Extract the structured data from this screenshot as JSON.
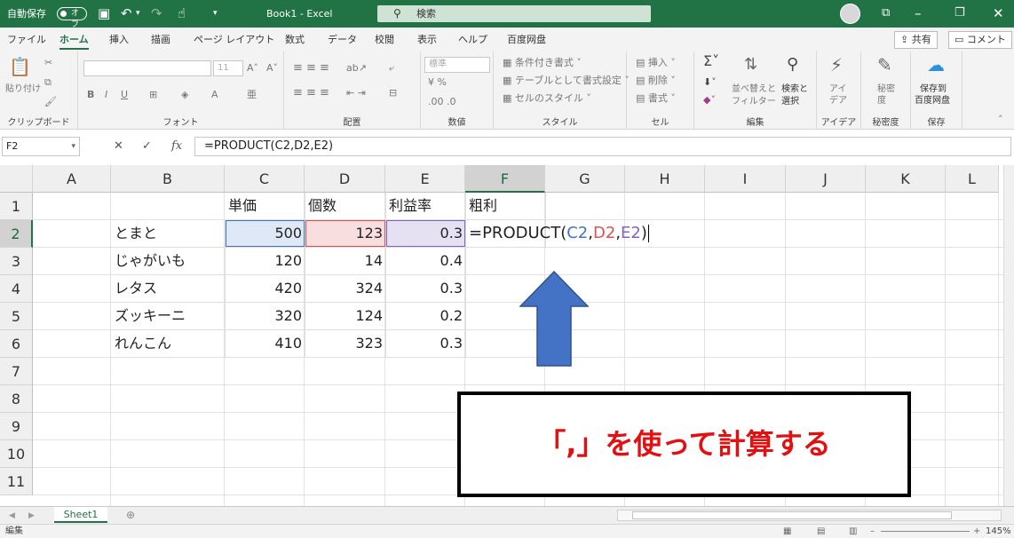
{
  "titlebar": {
    "autosave_label": "自動保存",
    "autosave_state": "オフ",
    "app_title": "Book1  -  Excel",
    "search_placeholder": "検索"
  },
  "menu": {
    "tabs": [
      "ファイル",
      "ホーム",
      "挿入",
      "描画",
      "ページ レイアウト",
      "数式",
      "データ",
      "校閲",
      "表示",
      "ヘルプ",
      "百度网盘"
    ],
    "active": "ホーム",
    "share": "共有",
    "comment": "コメント"
  },
  "ribbon": {
    "clipboard": {
      "label": "クリップボード",
      "paste": "貼り付け"
    },
    "font": {
      "label": "フォント",
      "size": "11"
    },
    "alignment": {
      "label": "配置"
    },
    "number": {
      "label": "数値",
      "format": "標準"
    },
    "styles": {
      "label": "スタイル",
      "conditional": "条件付き書式",
      "table": "テーブルとして書式設定",
      "cell_styles": "セルのスタイル"
    },
    "cells": {
      "label": "セル",
      "insert": "挿入",
      "delete": "削除",
      "format": "書式"
    },
    "editing": {
      "label": "編集",
      "sort": "並べ替えと",
      "filter": "フィルター",
      "find": "検索と",
      "select": "選択"
    },
    "ideas": {
      "label": "アイデア",
      "name": "アイ\nデア"
    },
    "sensitivity": {
      "label": "秘密度",
      "name": "秘密\n度"
    },
    "save": {
      "label": "保存",
      "name1": "保存到",
      "name2": "百度网盘"
    }
  },
  "formula_bar": {
    "name_box": "F2",
    "formula": "=PRODUCT(C2,D2,E2)"
  },
  "grid": {
    "columns": [
      "A",
      "B",
      "C",
      "D",
      "E",
      "F",
      "G",
      "H",
      "I",
      "J",
      "K",
      "L"
    ],
    "selected_column": "F",
    "rows": [
      "1",
      "2",
      "3",
      "4",
      "5",
      "6",
      "7",
      "8",
      "9",
      "10",
      "11"
    ],
    "selected_row": "2",
    "headers": {
      "C": "単価",
      "D": "個数",
      "E": "利益率",
      "F": "粗利"
    },
    "data": [
      {
        "name": "とまと",
        "price": "500",
        "qty": "123",
        "margin": "0.3"
      },
      {
        "name": "じゃがいも",
        "price": "120",
        "qty": "14",
        "margin": "0.4"
      },
      {
        "name": "レタス",
        "price": "420",
        "qty": "324",
        "margin": "0.3"
      },
      {
        "name": "ズッキーニ",
        "price": "320",
        "qty": "124",
        "margin": "0.2"
      },
      {
        "name": "れんこん",
        "price": "410",
        "qty": "323",
        "margin": "0.3"
      }
    ],
    "edit_formula": {
      "prefix": "=PRODUCT(",
      "ref1": "C2",
      "sep1": ",",
      "ref2": "D2",
      "sep2": ",",
      "ref3": "E2",
      "suffix": ")"
    }
  },
  "annotation": {
    "callout_text": "「,」を使って計算する",
    "arrow_color": "#4472c4",
    "text_color": "#e21010"
  },
  "sheet_tabs": {
    "active": "Sheet1"
  },
  "status": {
    "mode": "編集",
    "zoom": "145%"
  },
  "colors": {
    "accent": "#217346",
    "ref_c": "#4472c4",
    "ref_d": "#d9534f",
    "ref_e": "#8063c6"
  }
}
